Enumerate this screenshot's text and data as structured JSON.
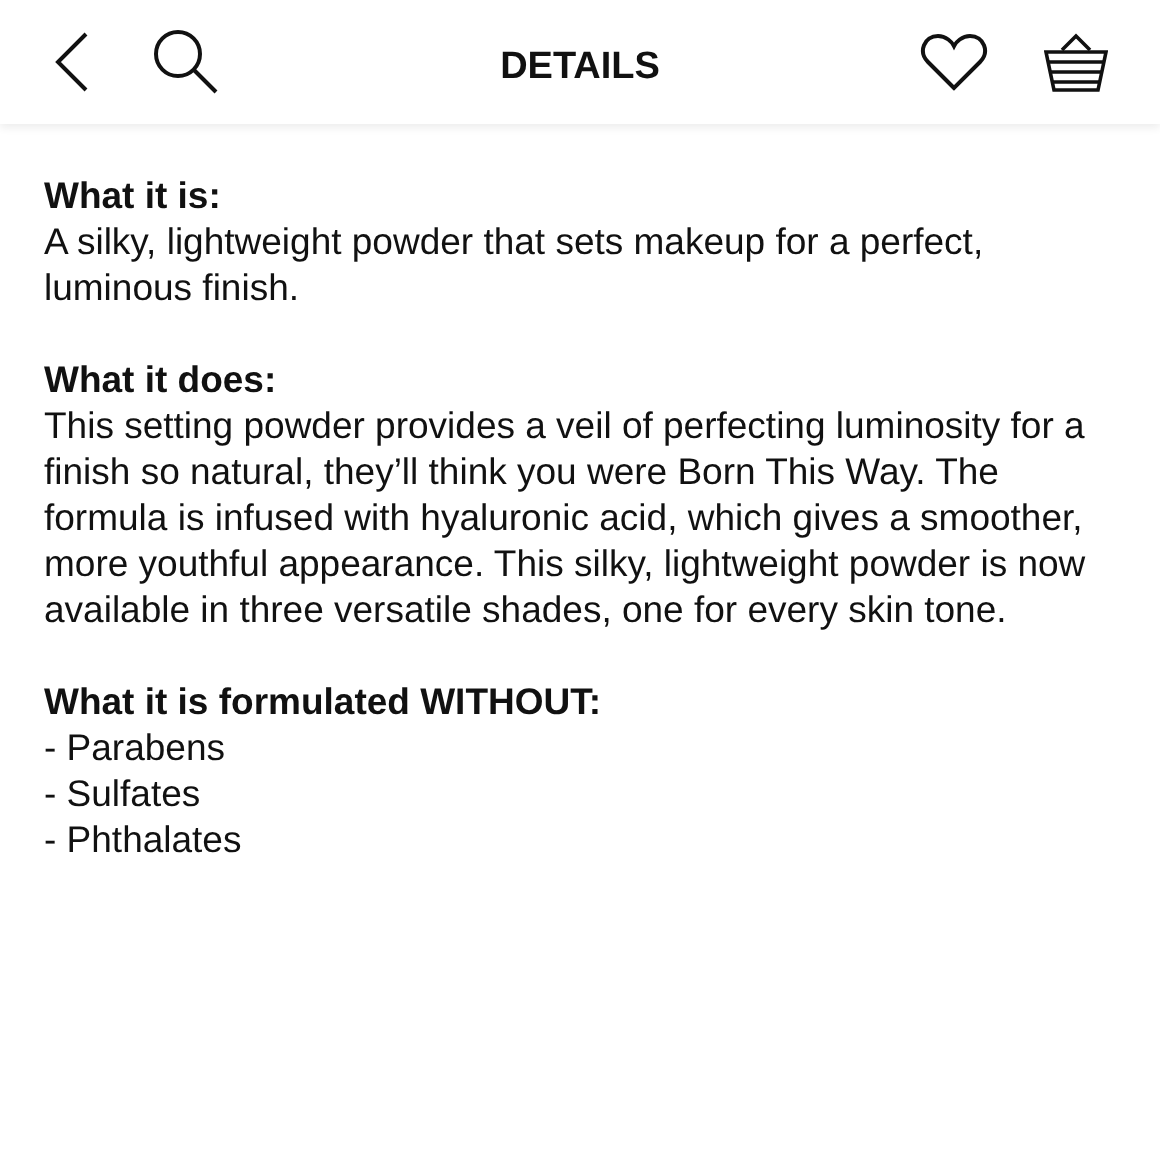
{
  "header": {
    "title": "DETAILS"
  },
  "sections": [
    {
      "heading": "What it is:",
      "kind": "paragraph",
      "text": "A silky, lightweight powder that sets makeup for a perfect, luminous finish."
    },
    {
      "heading": "What it does:",
      "kind": "paragraph",
      "text": "This setting powder provides a veil of perfecting luminosity for a finish so natural, they’ll think you were Born This Way. The formula is infused with hyaluronic acid, which gives a smoother, more youthful appearance. This silky, lightweight powder is now available in three versatile shades, one for every skin tone."
    },
    {
      "heading": "What it is formulated WITHOUT:",
      "kind": "list",
      "items": [
        "- Parabens",
        "- Sulfates",
        "- Phthalates"
      ]
    }
  ]
}
